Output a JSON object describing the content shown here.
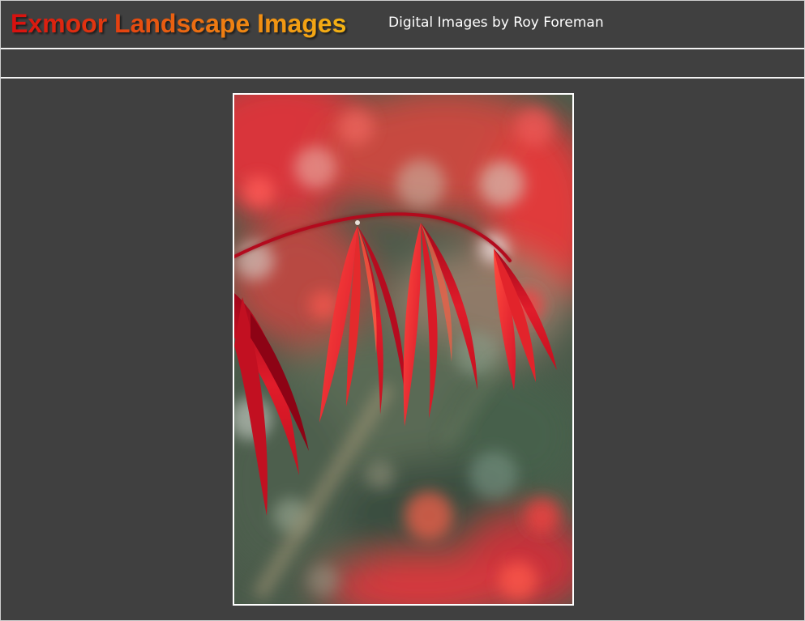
{
  "header": {
    "site_title": "Exmoor Landscape Images",
    "tagline": "Digital Images by Roy Foreman"
  },
  "colors": {
    "background": "#404040",
    "rule": "#f2f2f2",
    "title_gradient_start": "#d80f0f",
    "title_gradient_end": "#f4b414",
    "tagline_text": "#ffffff",
    "photo_border": "#ffffff"
  },
  "main": {
    "photo": {
      "alt": "Red Japanese maple leaves on a branch, backlit against a blurred background"
    }
  }
}
